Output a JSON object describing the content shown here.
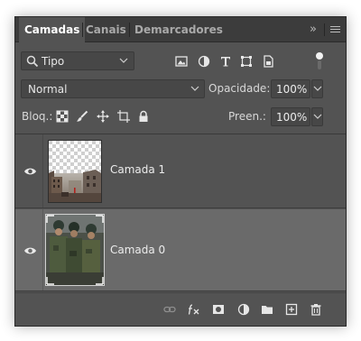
{
  "tabs": [
    {
      "label": "Camadas",
      "active": true
    },
    {
      "label": "Canais",
      "active": false
    },
    {
      "label": "Demarcadores",
      "active": false
    }
  ],
  "tab_bar": {
    "expand_label": "»",
    "menu_icon": "hamburger-menu-icon"
  },
  "filter": {
    "kind_label": "Tipo",
    "icons": [
      "image-filter-icon",
      "adjustment-filter-icon",
      "type-filter-icon",
      "shape-filter-icon",
      "smart-object-filter-icon"
    ],
    "toggle_on": true
  },
  "blend": {
    "mode": "Normal",
    "opacity_label": "Opacidade:",
    "opacity_value": "100%"
  },
  "lock": {
    "label": "Bloq.:",
    "icons": [
      "lock-transparent-pixels-icon",
      "lock-image-pixels-icon",
      "lock-position-icon",
      "lock-artboard-icon",
      "lock-all-icon"
    ],
    "fill_label": "Preen.:",
    "fill_value": "100%"
  },
  "layers": [
    {
      "name": "Camada 1",
      "visible": true,
      "selected": false,
      "thumbnail": "ruined-city-street-with-transparency"
    },
    {
      "name": "Camada 0",
      "visible": true,
      "selected": true,
      "thumbnail": "group-of-soldiers"
    }
  ],
  "bottom_icons": [
    "link-layers-icon",
    "fx-layer-style-icon",
    "add-mask-icon",
    "new-adjustment-layer-icon",
    "new-group-icon",
    "new-layer-icon",
    "delete-layer-icon"
  ],
  "colors": {
    "panel_bg": "#535353",
    "tabbar_bg": "#3c3c3c",
    "selected_layer_bg": "#6a6a6a",
    "field_bg": "#474747"
  }
}
